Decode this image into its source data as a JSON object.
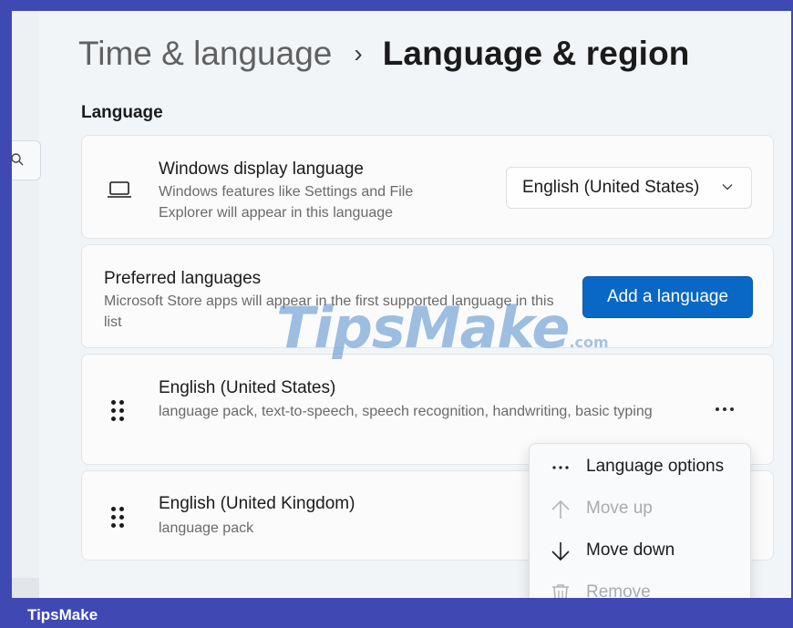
{
  "breadcrumb": {
    "parent": "Time & language",
    "separator": "›",
    "current": "Language & region"
  },
  "language_section": {
    "title": "Language"
  },
  "display_language": {
    "icon": "laptop-icon",
    "title": "Windows display language",
    "description": "Windows features like Settings and File Explorer will appear in this language",
    "selected": "English (United States)"
  },
  "preferred_languages": {
    "title": "Preferred languages",
    "description": "Microsoft Store apps will appear in the first supported language in this list",
    "add_button_label": "Add a language"
  },
  "languages": [
    {
      "name": "English (United States)",
      "features": "language pack, text-to-speech, speech recognition, handwriting, basic typing"
    },
    {
      "name": "English (United Kingdom)",
      "features": "language pack"
    }
  ],
  "context_menu": {
    "items": [
      {
        "label": "Language options",
        "icon": "more-horizontal-icon",
        "enabled": true
      },
      {
        "label": "Move up",
        "icon": "arrow-up-icon",
        "enabled": false
      },
      {
        "label": "Move down",
        "icon": "arrow-down-icon",
        "enabled": true
      },
      {
        "label": "Remove",
        "icon": "trash-icon",
        "enabled": false
      }
    ]
  },
  "watermark": {
    "main": "TipsMake",
    "suffix": ".com"
  },
  "footer": {
    "label": "TipsMake"
  },
  "colors": {
    "accent_button": "#0967c5",
    "frame_border": "#3f48b3",
    "page_background": "#f2f5f8"
  }
}
